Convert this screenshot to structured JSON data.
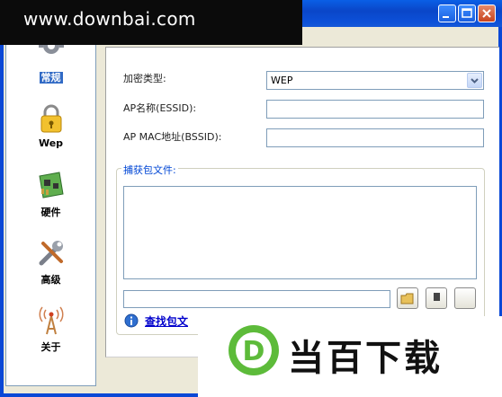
{
  "watermark": {
    "text": "www.downbai.com"
  },
  "sidebar": {
    "items": [
      {
        "label": "常规",
        "icon": "gear-icon",
        "selected": true
      },
      {
        "label": "Wep",
        "icon": "lock-icon",
        "selected": false
      },
      {
        "label": "硬件",
        "icon": "circuit-board-icon",
        "selected": false
      },
      {
        "label": "高级",
        "icon": "tools-icon",
        "selected": false
      },
      {
        "label": "关于",
        "icon": "antenna-icon",
        "selected": false
      }
    ]
  },
  "form": {
    "encryption_label": "加密类型:",
    "encryption_value": "WEP",
    "essid_label": "AP名称(ESSID):",
    "essid_value": "",
    "bssid_label": "AP MAC地址(BSSID):",
    "bssid_value": ""
  },
  "capture": {
    "group_title": "捕获包文件:",
    "path_value": "",
    "find_link": "查找包文"
  },
  "logo": {
    "text": "当百下载",
    "mark": "D"
  },
  "colors": {
    "titlebar": "#0A46C8",
    "selection": "#316AC5",
    "link": "#0000CC",
    "logo_green": "#5DBB3A"
  }
}
